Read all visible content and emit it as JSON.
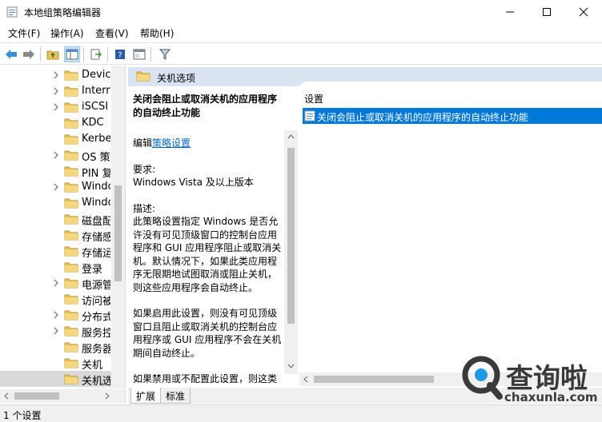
{
  "window": {
    "title": "本地组策略编辑器",
    "controls": [
      "minimize-icon",
      "maximize-icon",
      "close-icon"
    ]
  },
  "menu": {
    "items": [
      "文件(F)",
      "操作(A)",
      "查看(V)",
      "帮助(H)"
    ]
  },
  "toolbar": {
    "buttons": [
      "back-arrow-icon",
      "forward-arrow-icon",
      "up-folder-icon",
      "show-hide-tree-icon",
      "export-list-icon",
      "help-icon",
      "properties-icon",
      "filter-icon"
    ]
  },
  "tree": {
    "items": [
      {
        "label": "Device",
        "expandable": true
      },
      {
        "label": "Intern",
        "expandable": true
      },
      {
        "label": "iSCSI",
        "expandable": true
      },
      {
        "label": "KDC",
        "expandable": false
      },
      {
        "label": "Kerbe",
        "expandable": false
      },
      {
        "label": "OS 策",
        "expandable": true
      },
      {
        "label": "PIN 复",
        "expandable": false
      },
      {
        "label": "Windo",
        "expandable": true
      },
      {
        "label": "Windo",
        "expandable": false
      },
      {
        "label": "磁盘配",
        "expandable": false
      },
      {
        "label": "存储感",
        "expandable": false
      },
      {
        "label": "存储运",
        "expandable": false
      },
      {
        "label": "登录",
        "expandable": false
      },
      {
        "label": "电源管",
        "expandable": true
      },
      {
        "label": "访问被",
        "expandable": false
      },
      {
        "label": "分布式",
        "expandable": true
      },
      {
        "label": "服务控",
        "expandable": true
      },
      {
        "label": "服务器",
        "expandable": false
      },
      {
        "label": "关机",
        "expandable": false
      },
      {
        "label": "关机选",
        "expandable": false,
        "selected": true
      }
    ]
  },
  "pane": {
    "header": "关机选项"
  },
  "description": {
    "title": "关闭会阻止或取消关机的应用程序的自动终止功能",
    "edit_prefix": "编辑",
    "edit_link": "策略设置",
    "requirements_label": "要求:",
    "requirements_value": "Windows Vista 及以上版本",
    "description_label": "描述:",
    "description_text": "此策略设置指定 Windows 是否允许没有可见顶级窗口的控制台应用程序和 GUI 应用程序阻止或取消关机。默认情况下，如果此类应用程序无限期地试图取消或阻止关机，则这些应用程序会自动终止。",
    "enabled_text": "如果启用此设置，则没有可见顶级窗口且阻止或取消关机的控制台应用程序或 GUI 应用程序不会在关机期间自动终止。",
    "cut_text": "如果禁用或不配置此设置，则这类"
  },
  "settings_list": {
    "column_header": "设置",
    "rows": [
      {
        "label": "关闭会阻止或取消关机的应用程序的自动终止功能",
        "selected": true
      }
    ]
  },
  "tabs": {
    "items": [
      "扩展",
      "标准"
    ]
  },
  "status": {
    "text": "1 个设置"
  },
  "watermark": {
    "main": "查询啦",
    "sub": "chaxunla.com"
  },
  "colors": {
    "selection": "#0078d7",
    "header_band": "#d9e4f0",
    "link": "#0066cc",
    "folder": "#e8c15a"
  }
}
